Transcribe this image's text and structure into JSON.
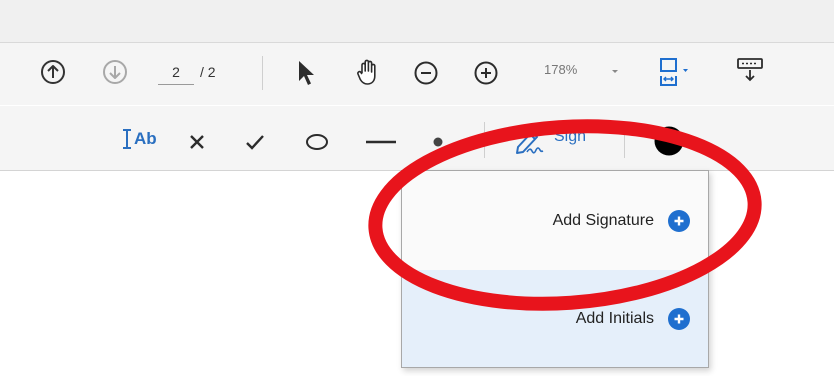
{
  "navigation": {
    "current_page": "2",
    "total_pages": "/ 2"
  },
  "zoom": {
    "level": "178%"
  },
  "fill_sign_toolbar": {
    "text_tool_label": "Ab",
    "sign_label": "Sign"
  },
  "sign_menu": {
    "items": [
      {
        "label": "Add Signature"
      },
      {
        "label": "Add Initials"
      }
    ]
  },
  "colors": {
    "accent": "#1f6fcf",
    "annotation": "#e8141c",
    "toolbar_bg": "#f5f5f5",
    "menu_hover": "#e5effa"
  },
  "icons": {
    "toolbar1": [
      "previous-page-icon",
      "next-page-icon",
      "select-arrow-icon",
      "hand-tool-icon",
      "zoom-out-icon",
      "zoom-in-icon",
      "page-fit-icon",
      "keyboard-icon"
    ],
    "toolbar2": [
      "add-text-icon",
      "cross-mark-icon",
      "check-mark-icon",
      "ellipse-icon",
      "line-icon",
      "dot-icon",
      "sign-pen-icon",
      "color-swatch-icon"
    ]
  }
}
